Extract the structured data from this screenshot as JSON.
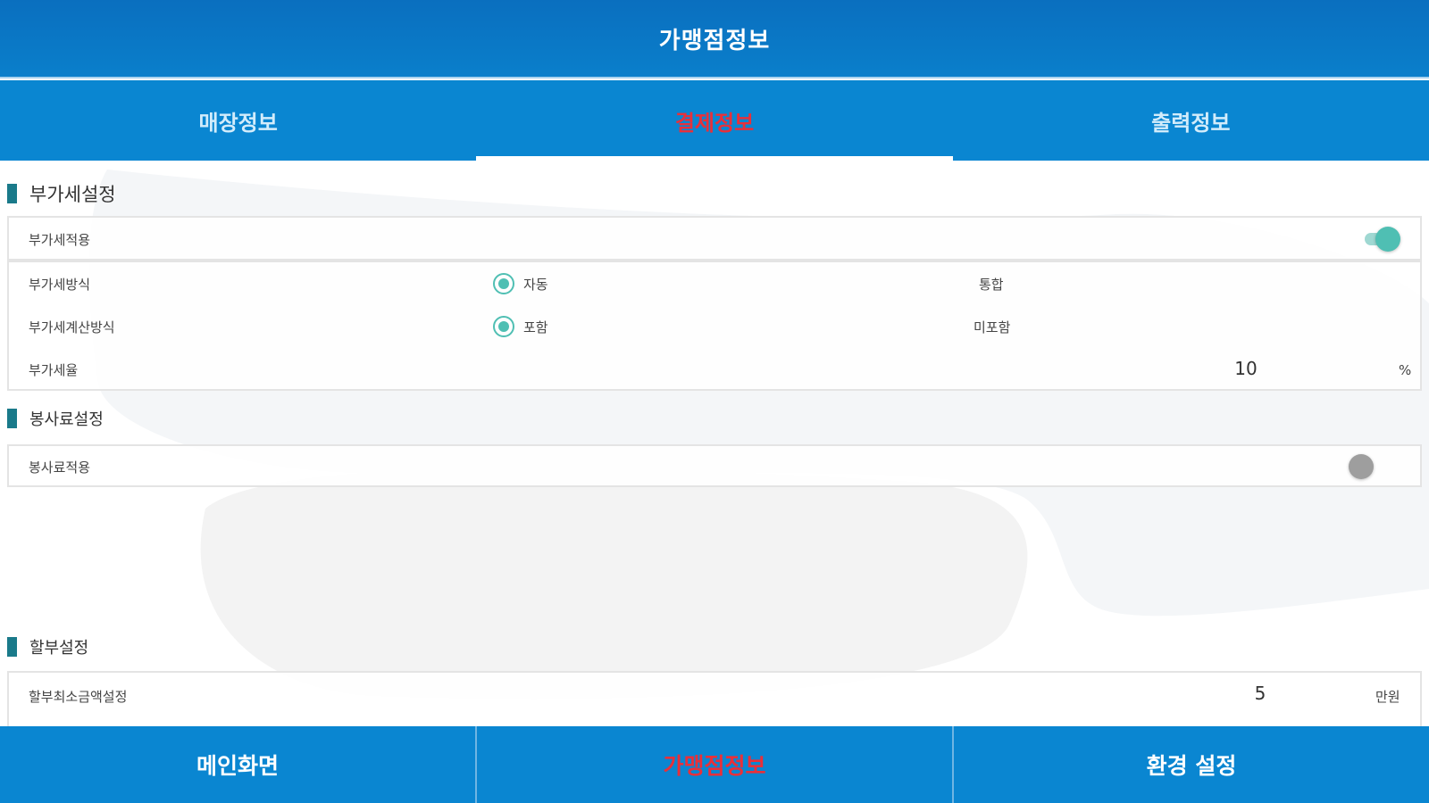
{
  "header": {
    "title": "가맹점정보"
  },
  "tabs": [
    {
      "label": "매장정보",
      "active": false
    },
    {
      "label": "결제정보",
      "active": true
    },
    {
      "label": "출력정보",
      "active": false
    }
  ],
  "vat_section": {
    "title": "부가세설정",
    "apply_label": "부가세적용",
    "apply_enabled": true,
    "method_label": "부가세방식",
    "method_options": [
      "자동",
      "통합"
    ],
    "method_selected": "자동",
    "calc_label": "부가세계산방식",
    "calc_options": [
      "포함",
      "미포함"
    ],
    "calc_selected": "포함",
    "rate_label": "부가세율",
    "rate_value": "10",
    "rate_unit": "%"
  },
  "service_section": {
    "title": "봉사료설정",
    "apply_label": "봉사료적용",
    "apply_enabled": false
  },
  "installment_section": {
    "title": "할부설정",
    "min_amount_label": "할부최소금액설정",
    "min_amount_value": "5",
    "min_amount_unit": "만원"
  },
  "bottom_nav": [
    {
      "label": "메인화면",
      "active": false
    },
    {
      "label": "가맹점정보",
      "active": true
    },
    {
      "label": "환경 설정",
      "active": false
    }
  ],
  "colors": {
    "primary_blue": "#0a86d1",
    "active_red": "#e8303a",
    "teal_accent": "#4fbfb3",
    "section_bar": "#1a7a8a"
  }
}
